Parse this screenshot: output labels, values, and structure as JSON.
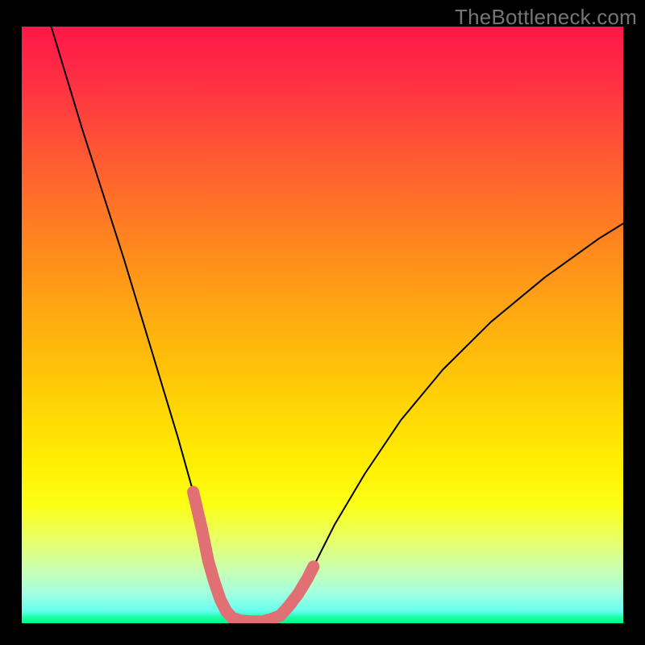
{
  "watermark": "TheBottleneck.com",
  "chart_data": {
    "type": "line",
    "title": "",
    "xlabel": "",
    "ylabel": "",
    "xlim": [
      0,
      100
    ],
    "ylim": [
      0,
      100
    ],
    "grid": false,
    "legend": false,
    "series": [
      {
        "name": "main-curve",
        "color": "#000000",
        "x": [
          4.9,
          7.0,
          10.0,
          13.5,
          17.0,
          20.0,
          23.0,
          26.0,
          28.5,
          30.5,
          32.0,
          33.5,
          35.0,
          37.0,
          40.0,
          43.0,
          45.5,
          48.0,
          52.0,
          57.0,
          63.0,
          70.0,
          78.0,
          87.0,
          96.0,
          100.0
        ],
        "y": [
          100.0,
          93.0,
          83.0,
          72.0,
          61.0,
          51.0,
          41.0,
          31.0,
          22.0,
          14.0,
          8.0,
          3.0,
          1.0,
          0.4,
          0.4,
          1.3,
          4.0,
          8.5,
          16.5,
          25.0,
          34.0,
          42.5,
          50.5,
          58.0,
          64.5,
          67.0
        ]
      }
    ],
    "highlight_segments": [
      {
        "name": "left-segment",
        "color": "#e07074",
        "x": [
          28.5,
          30.0,
          31.0,
          32.0,
          33.0,
          34.0
        ],
        "y": [
          22.0,
          15.5,
          10.5,
          7.0,
          4.0,
          2.0
        ]
      },
      {
        "name": "floor-segment",
        "color": "#e07074",
        "x": [
          34.0,
          35.0,
          36.5,
          38.0,
          40.0,
          41.5,
          43.0
        ],
        "y": [
          2.0,
          0.9,
          0.4,
          0.3,
          0.3,
          0.7,
          1.3
        ]
      },
      {
        "name": "right-segment",
        "color": "#e07074",
        "x": [
          43.0,
          44.5,
          46.0,
          47.5,
          48.5
        ],
        "y": [
          1.3,
          3.0,
          5.0,
          7.5,
          9.5
        ]
      }
    ],
    "background": {
      "type": "vertical-gradient",
      "stops": [
        {
          "pos": 0.0,
          "color": "#ff1748"
        },
        {
          "pos": 0.5,
          "color": "#ffb010"
        },
        {
          "pos": 0.75,
          "color": "#fff500"
        },
        {
          "pos": 1.0,
          "color": "#00ff88"
        }
      ]
    }
  }
}
